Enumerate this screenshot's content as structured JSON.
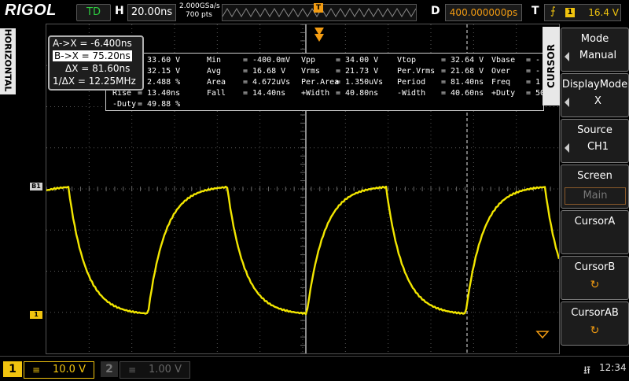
{
  "header": {
    "logo": "RIGOL",
    "run_state": "TD",
    "timebase_label": "H",
    "timebase": "20.00ns",
    "sample_rate": "2.000GSa/s",
    "memory_depth": "700  pts",
    "trigger_position_marker": "T",
    "delay_label": "D",
    "delay": "400.000000ps",
    "trigger_label": "T",
    "trigger_source": "1",
    "trigger_level": "16.4 V",
    "trigger_edge_icon": "rising-edge-icon"
  },
  "left_tab": {
    "label": "HORIZONTAL"
  },
  "channel_markers": {
    "b1": "B1",
    "ch1": "1"
  },
  "cursor_readout": {
    "a": "A->X = -6.400ns",
    "b": "B->X = 75.20ns",
    "delta": "ΔX = 81.60ns",
    "inv_delta": "1/ΔX = 12.25MHz"
  },
  "measurements": {
    "col1": [
      "= 33.60 V",
      "= 32.15 V",
      "= 2.488 %"
    ],
    "rise": [
      "Rise",
      "= 13.40ns"
    ],
    "neg_duty": [
      "-Duty",
      "= 49.88 %"
    ],
    "rows": [
      [
        "Min",
        "= -400.0mV",
        "Vpp",
        "= 34.00 V",
        "Vtop",
        "= 32.64 V",
        "Vbase",
        "= -"
      ],
      [
        "Avg",
        "= 16.68 V",
        "Vrms",
        "= 21.73 V",
        "Per.Vrms",
        "= 21.68 V",
        "Over",
        "= -"
      ],
      [
        "Area",
        "= 4.672uVs",
        "Per.Area",
        "= 1.350uVs",
        "Period",
        "= 81.40ns",
        "Freq",
        "= 1"
      ],
      [
        "Fall",
        "= 14.40ns",
        "+Width",
        "= 40.80ns",
        "-Width",
        "= 40.60ns",
        "+Duty",
        "= 50"
      ]
    ]
  },
  "menu": {
    "tab_label": "CURSOR",
    "items": [
      {
        "title": "Mode",
        "value": "Manual"
      },
      {
        "title": "DisplayMode",
        "value": "X"
      },
      {
        "title": "Source",
        "value": "CH1"
      },
      {
        "title": "Screen",
        "value": "Main"
      },
      {
        "title": "CursorA",
        "icon": "rotate-knob-icon"
      },
      {
        "title": "CursorB",
        "icon": "rotate-knob-icon"
      },
      {
        "title": "CursorAB",
        "icon": "rotate-knob-icon"
      }
    ]
  },
  "footer": {
    "ch1_number": "1",
    "ch1_coupling": "≡",
    "ch1_scale": "10.0 V",
    "ch2_number": "2",
    "ch2_coupling": "≡",
    "ch2_scale": "1.00 V",
    "clock": "12:34"
  },
  "colors": {
    "trace": "#f2e600",
    "accent_orange": "#f39c12",
    "ch1_yellow": "#f1c40f"
  }
}
